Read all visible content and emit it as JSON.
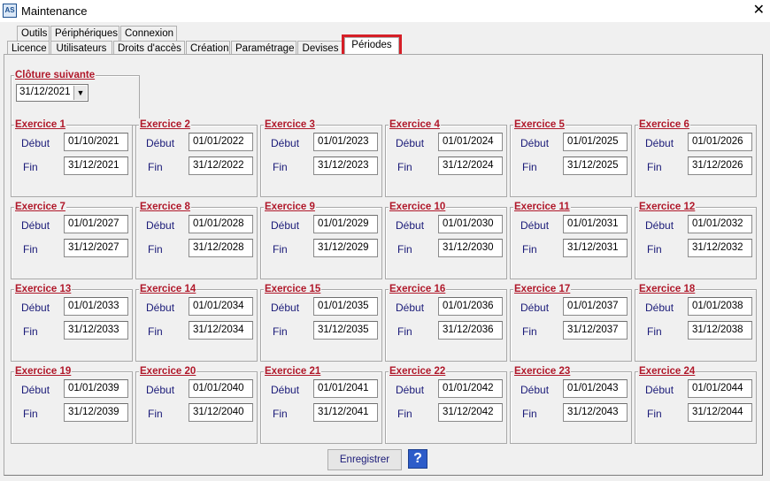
{
  "window": {
    "title": "Maintenance",
    "icon": "app-logo-icon",
    "close_glyph": "✕"
  },
  "tabs_top": [
    "Outils",
    "Périphériques",
    "Connexion"
  ],
  "tabs_bottom": [
    "Licence",
    "Utilisateurs",
    "Droits d'accès",
    "Création",
    "Paramétrage",
    "Devises",
    "Périodes"
  ],
  "selected_tab": "Périodes",
  "cloture": {
    "label": "Clôture suivante",
    "value": "31/12/2021"
  },
  "field_labels": {
    "debut": "Début",
    "fin": "Fin"
  },
  "exercices": [
    {
      "title": "Exercice 1",
      "debut": "01/10/2021",
      "fin": "31/12/2021"
    },
    {
      "title": "Exercice 2",
      "debut": "01/01/2022",
      "fin": "31/12/2022"
    },
    {
      "title": "Exercice 3",
      "debut": "01/01/2023",
      "fin": "31/12/2023"
    },
    {
      "title": "Exercice 4",
      "debut": "01/01/2024",
      "fin": "31/12/2024"
    },
    {
      "title": "Exercice 5",
      "debut": "01/01/2025",
      "fin": "31/12/2025"
    },
    {
      "title": "Exercice 6",
      "debut": "01/01/2026",
      "fin": "31/12/2026"
    },
    {
      "title": "Exercice 7",
      "debut": "01/01/2027",
      "fin": "31/12/2027"
    },
    {
      "title": "Exercice 8",
      "debut": "01/01/2028",
      "fin": "31/12/2028"
    },
    {
      "title": "Exercice 9",
      "debut": "01/01/2029",
      "fin": "31/12/2029"
    },
    {
      "title": "Exercice 10",
      "debut": "01/01/2030",
      "fin": "31/12/2030"
    },
    {
      "title": "Exercice 11",
      "debut": "01/01/2031",
      "fin": "31/12/2031"
    },
    {
      "title": "Exercice 12",
      "debut": "01/01/2032",
      "fin": "31/12/2032"
    },
    {
      "title": "Exercice 13",
      "debut": "01/01/2033",
      "fin": "31/12/2033"
    },
    {
      "title": "Exercice 14",
      "debut": "01/01/2034",
      "fin": "31/12/2034"
    },
    {
      "title": "Exercice 15",
      "debut": "01/01/2035",
      "fin": "31/12/2035"
    },
    {
      "title": "Exercice 16",
      "debut": "01/01/2036",
      "fin": "31/12/2036"
    },
    {
      "title": "Exercice 17",
      "debut": "01/01/2037",
      "fin": "31/12/2037"
    },
    {
      "title": "Exercice 18",
      "debut": "01/01/2038",
      "fin": "31/12/2038"
    },
    {
      "title": "Exercice 19",
      "debut": "01/01/2039",
      "fin": "31/12/2039"
    },
    {
      "title": "Exercice 20",
      "debut": "01/01/2040",
      "fin": "31/12/2040"
    },
    {
      "title": "Exercice 21",
      "debut": "01/01/2041",
      "fin": "31/12/2041"
    },
    {
      "title": "Exercice 22",
      "debut": "01/01/2042",
      "fin": "31/12/2042"
    },
    {
      "title": "Exercice 23",
      "debut": "01/01/2043",
      "fin": "31/12/2043"
    },
    {
      "title": "Exercice 24",
      "debut": "01/01/2044",
      "fin": "31/12/2044"
    }
  ],
  "buttons": {
    "save": "Enregistrer",
    "help": "?"
  },
  "colors": {
    "group_title": "#b0182a",
    "label": "#1a1a78",
    "highlight": "#d61f27",
    "help": "#2d5cc9"
  }
}
